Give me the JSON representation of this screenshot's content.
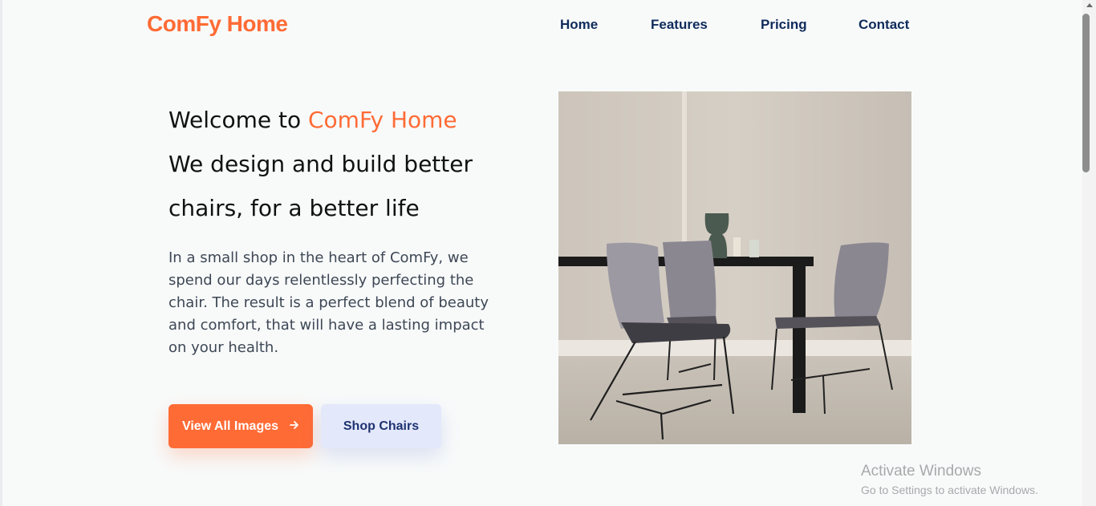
{
  "header": {
    "logo": "ComFy Home",
    "nav": [
      {
        "label": "Home"
      },
      {
        "label": "Features"
      },
      {
        "label": "Pricing"
      },
      {
        "label": "Contact"
      }
    ]
  },
  "hero": {
    "title_prefix": "Welcome to ",
    "title_brand": "ComFy Home",
    "title_line2": "We design and build better chairs, for a better life",
    "description": "In a small shop in the heart of ComFy, we spend our days relentlessly perfecting the chair. The result is a perfect blend of beauty and comfort, that will have a lasting impact on your health.",
    "primary_button": "View All Images",
    "primary_icon": "arrow-right-icon",
    "secondary_button": "Shop Chairs"
  },
  "image": {
    "alt": "dining-room-chairs-photo"
  },
  "watermark": {
    "title": "Activate Windows",
    "subtitle": "Go to Settings to activate Windows."
  },
  "colors": {
    "accent": "#ff6b35",
    "nav_text": "#0f2b5b",
    "secondary_button_bg": "#e3e8fb",
    "background": "#f8fafa"
  }
}
